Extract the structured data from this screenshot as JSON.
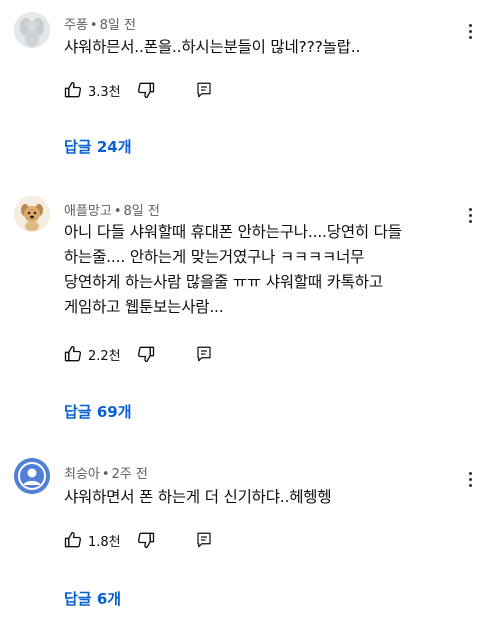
{
  "comments": [
    {
      "author": "주퐁",
      "time": "8일 전",
      "text": "샤워하믄서..폰을..하시는분들이 많네???놀랍..",
      "likes": "3.3천",
      "replies": "답글 24개",
      "avatar_icon": "angel-statue-icon"
    },
    {
      "author": "애플망고",
      "time": "8일 전",
      "text": "아니 다들 샤워할때 휴대폰 안하는구나....당연히 다들\n하는줄.... 안하는게 맞는거였구나 ㅋㅋㅋㅋ너무\n당연하게 하는사람 많을줄 ㅠㅠ 샤워할때 카톡하고\n게임하고 웹툰보는사람...",
      "likes": "2.2천",
      "replies": "답글 69개",
      "avatar_icon": "puppy-icon"
    },
    {
      "author": "최승아",
      "time": "2주 전",
      "text": "샤워하면서 폰 하는게 더 신기하댜..헤헹헹",
      "likes": "1.8천",
      "replies": "답글 6개",
      "avatar_icon": "default-user-icon"
    }
  ],
  "separator": "•",
  "colors": {
    "link": "#065fd4",
    "meta": "#606060",
    "text": "#0f0f0f",
    "default_avatar": "#4f7fd6"
  }
}
